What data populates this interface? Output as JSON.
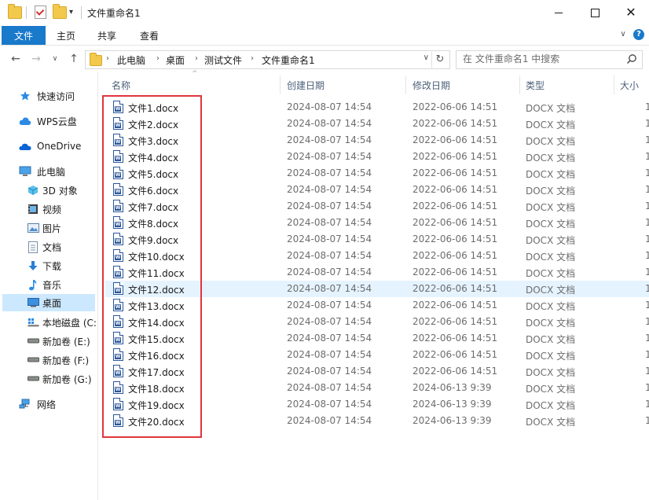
{
  "window": {
    "title": "文件重命名1",
    "quick_access_arrow": "▾",
    "minimize": "—",
    "maximize": "☐",
    "close": "✕"
  },
  "ribbon": {
    "file_tab": "文件",
    "tabs": [
      "主页",
      "共享",
      "查看"
    ],
    "expand_chevron": "∨",
    "help": "?"
  },
  "address": {
    "back": "←",
    "forward": "→",
    "recent": "∨",
    "up": "↑",
    "crumbs": [
      "此电脑",
      "桌面",
      "测试文件",
      "文件重命名1"
    ],
    "separator": "›",
    "dropdown": "∨",
    "refresh": "↻"
  },
  "search": {
    "placeholder": "在 文件重命名1 中搜索"
  },
  "nav": {
    "items": [
      {
        "label": "快速访问",
        "icon": "star-icon"
      },
      {
        "label": "WPS云盘",
        "icon": "cloud-icon"
      },
      {
        "label": "OneDrive",
        "icon": "onedrive-icon"
      },
      {
        "label": "此电脑",
        "icon": "computer-icon"
      },
      {
        "label": "3D 对象",
        "icon": "cube-icon"
      },
      {
        "label": "视频",
        "icon": "video-icon"
      },
      {
        "label": "图片",
        "icon": "picture-icon"
      },
      {
        "label": "文档",
        "icon": "document-icon"
      },
      {
        "label": "下载",
        "icon": "download-icon"
      },
      {
        "label": "音乐",
        "icon": "music-icon"
      },
      {
        "label": "桌面",
        "icon": "desktop-icon"
      },
      {
        "label": "本地磁盘 (C:",
        "icon": "drive-c-icon"
      },
      {
        "label": "新加卷 (E:)",
        "icon": "drive-icon"
      },
      {
        "label": "新加卷 (F:)",
        "icon": "drive-icon"
      },
      {
        "label": "新加卷 (G:)",
        "icon": "drive-icon"
      },
      {
        "label": "网络",
        "icon": "network-icon"
      }
    ]
  },
  "columns": {
    "name": "名称",
    "created": "创建日期",
    "modified": "修改日期",
    "type": "类型",
    "size": "大小",
    "sort_indicator": "^"
  },
  "files": [
    {
      "name": "文件1.docx",
      "created": "2024-08-07 14:54",
      "modified": "2022-06-06 14:51",
      "type": "DOCX 文档",
      "size": "1"
    },
    {
      "name": "文件2.docx",
      "created": "2024-08-07 14:54",
      "modified": "2022-06-06 14:51",
      "type": "DOCX 文档",
      "size": "1"
    },
    {
      "name": "文件3.docx",
      "created": "2024-08-07 14:54",
      "modified": "2022-06-06 14:51",
      "type": "DOCX 文档",
      "size": "1"
    },
    {
      "name": "文件4.docx",
      "created": "2024-08-07 14:54",
      "modified": "2022-06-06 14:51",
      "type": "DOCX 文档",
      "size": "1"
    },
    {
      "name": "文件5.docx",
      "created": "2024-08-07 14:54",
      "modified": "2022-06-06 14:51",
      "type": "DOCX 文档",
      "size": "1"
    },
    {
      "name": "文件6.docx",
      "created": "2024-08-07 14:54",
      "modified": "2022-06-06 14:51",
      "type": "DOCX 文档",
      "size": "1"
    },
    {
      "name": "文件7.docx",
      "created": "2024-08-07 14:54",
      "modified": "2022-06-06 14:51",
      "type": "DOCX 文档",
      "size": "1"
    },
    {
      "name": "文件8.docx",
      "created": "2024-08-07 14:54",
      "modified": "2022-06-06 14:51",
      "type": "DOCX 文档",
      "size": "1"
    },
    {
      "name": "文件9.docx",
      "created": "2024-08-07 14:54",
      "modified": "2022-06-06 14:51",
      "type": "DOCX 文档",
      "size": "1"
    },
    {
      "name": "文件10.docx",
      "created": "2024-08-07 14:54",
      "modified": "2022-06-06 14:51",
      "type": "DOCX 文档",
      "size": "1"
    },
    {
      "name": "文件11.docx",
      "created": "2024-08-07 14:54",
      "modified": "2022-06-06 14:51",
      "type": "DOCX 文档",
      "size": "1"
    },
    {
      "name": "文件12.docx",
      "created": "2024-08-07 14:54",
      "modified": "2022-06-06 14:51",
      "type": "DOCX 文档",
      "size": "1"
    },
    {
      "name": "文件13.docx",
      "created": "2024-08-07 14:54",
      "modified": "2022-06-06 14:51",
      "type": "DOCX 文档",
      "size": "1"
    },
    {
      "name": "文件14.docx",
      "created": "2024-08-07 14:54",
      "modified": "2022-06-06 14:51",
      "type": "DOCX 文档",
      "size": "1"
    },
    {
      "name": "文件15.docx",
      "created": "2024-08-07 14:54",
      "modified": "2022-06-06 14:51",
      "type": "DOCX 文档",
      "size": "1"
    },
    {
      "name": "文件16.docx",
      "created": "2024-08-07 14:54",
      "modified": "2022-06-06 14:51",
      "type": "DOCX 文档",
      "size": "1"
    },
    {
      "name": "文件17.docx",
      "created": "2024-08-07 14:54",
      "modified": "2022-06-06 14:51",
      "type": "DOCX 文档",
      "size": "1"
    },
    {
      "name": "文件18.docx",
      "created": "2024-08-07 14:54",
      "modified": "2024-06-13 9:39",
      "type": "DOCX 文档",
      "size": "1"
    },
    {
      "name": "文件19.docx",
      "created": "2024-08-07 14:54",
      "modified": "2024-06-13 9:39",
      "type": "DOCX 文档",
      "size": "1"
    },
    {
      "name": "文件20.docx",
      "created": "2024-08-07 14:54",
      "modified": "2024-06-13 9:39",
      "type": "DOCX 文档",
      "size": "1"
    }
  ],
  "file_icon_letter": "W",
  "colors": {
    "accent": "#1979ca",
    "selection": "#cce8ff",
    "hover_row": "#e5f3ff",
    "highlight_border": "#e0363c",
    "word_blue": "#2b579a"
  }
}
